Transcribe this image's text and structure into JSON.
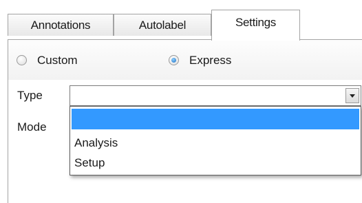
{
  "tabs": [
    {
      "label": "Annotations"
    },
    {
      "label": "Autolabel"
    },
    {
      "label": "Settings",
      "active": true
    }
  ],
  "mode_radios": [
    {
      "label": "Custom",
      "checked": false
    },
    {
      "label": "Express",
      "checked": true
    }
  ],
  "type_field": {
    "label": "Type",
    "value": "",
    "options": [
      "",
      "Analysis",
      "Setup"
    ],
    "selected_option": ""
  },
  "mode_field": {
    "label": "Mode"
  },
  "colors": {
    "selection": "#3399ff",
    "border": "#a3a3a3"
  }
}
